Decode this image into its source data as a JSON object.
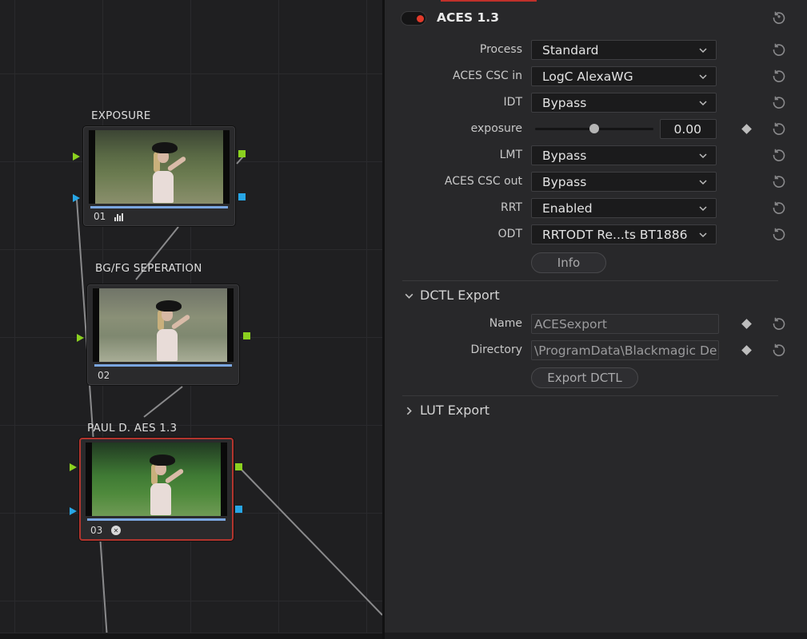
{
  "nodes": [
    {
      "label": "EXPOSURE",
      "num": "01",
      "icon": "bars-icon"
    },
    {
      "label": "BG/FG SEPERATION",
      "num": "02",
      "icon": ""
    },
    {
      "label": "PAUL D. AES 1.3",
      "num": "03",
      "icon": "aces-icon"
    }
  ],
  "inspector": {
    "title": "ACES 1.3",
    "enabled": true,
    "params": [
      {
        "label": "Process",
        "value": "Standard",
        "type": "dropdown"
      },
      {
        "label": "ACES CSC in",
        "value": "LogC AlexaWG",
        "type": "dropdown"
      },
      {
        "label": "IDT",
        "value": "Bypass",
        "type": "dropdown"
      },
      {
        "label": "exposure",
        "value": "0.00",
        "type": "slider",
        "level": 0.5
      },
      {
        "label": "LMT",
        "value": "Bypass",
        "type": "dropdown"
      },
      {
        "label": "ACES CSC out",
        "value": "Bypass",
        "type": "dropdown"
      },
      {
        "label": "RRT",
        "value": "Enabled",
        "type": "dropdown"
      },
      {
        "label": "ODT",
        "value": "RRTODT Re...ts BT1886",
        "type": "dropdown"
      }
    ],
    "info_button": "Info",
    "dctl_export": {
      "title": "DCTL Export",
      "expanded": true,
      "name_label": "Name",
      "name_value": "ACESexport",
      "directory_label": "Directory",
      "directory_value": "\\ProgramData\\Blackmagic De",
      "export_button": "Export DCTL"
    },
    "lut_export": {
      "title": "LUT Export",
      "expanded": false
    }
  },
  "colors": {
    "accent_red": "#e23a2a",
    "selected_border": "#b2352e",
    "port_green": "#8bd11f",
    "port_blue": "#27a6e6"
  }
}
